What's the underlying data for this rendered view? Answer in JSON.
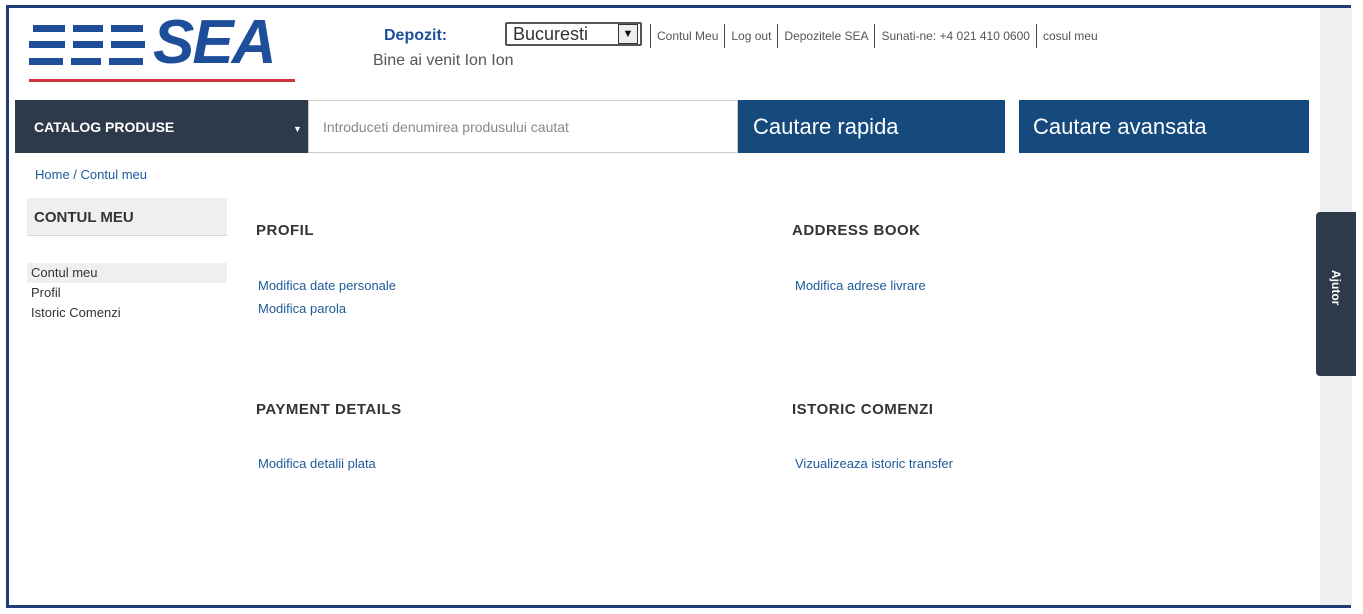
{
  "logo": {
    "text": "SEA"
  },
  "header": {
    "depozit_label": "Depozit:",
    "welcome": "Bine ai venit Ion Ion",
    "depozit_select": "Bucuresti",
    "links": [
      "Contul Meu",
      "Log out",
      "Depozitele SEA",
      "Sunati-ne: +4 021 410 0600",
      "cosul meu"
    ]
  },
  "nav": {
    "catalog_label": "CATALOG PRODUSE",
    "search_placeholder": "Introduceti denumirea produsului cautat",
    "quick_search": "Cautare rapida",
    "advanced_search": "Cautare avansata"
  },
  "breadcrumb": {
    "home": "Home",
    "sep": " / ",
    "current": "Contul meu"
  },
  "sidebar": {
    "title": "CONTUL MEU",
    "items": [
      "Contul meu",
      "Profil",
      "Istoric Comenzi"
    ]
  },
  "sections": {
    "profil": {
      "title": "PROFIL",
      "links": [
        "Modifica date personale",
        "Modifica parola"
      ]
    },
    "address": {
      "title": "ADDRESS BOOK",
      "links": [
        "Modifica adrese livrare"
      ]
    },
    "payment": {
      "title": "PAYMENT DETAILS",
      "links": [
        "Modifica detalii plata"
      ]
    },
    "istoric": {
      "title": "ISTORIC COMENZI",
      "links": [
        "Vizualizeaza istoric transfer"
      ]
    }
  },
  "help_tab": "Ajutor",
  "colors": {
    "brand_blue": "#1e4e9a",
    "nav_dark": "#2d3a4a",
    "button_blue": "#164a7d",
    "logo_red": "#d0343a"
  }
}
